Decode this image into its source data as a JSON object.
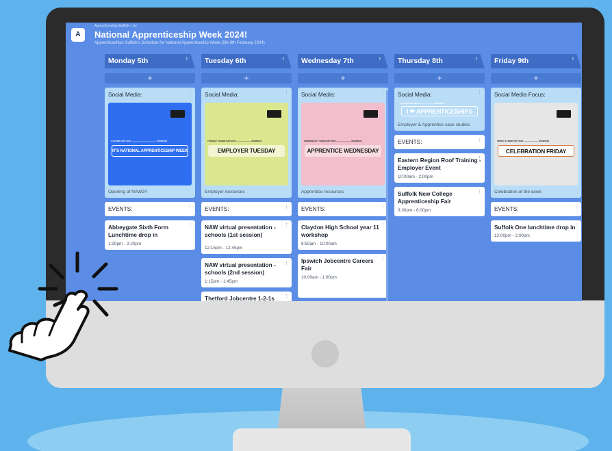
{
  "board": {
    "author": "ApprenticeshipsSuffolk • 1w",
    "logo_letter": "A",
    "title": "National Apprenticeship Week 2024!",
    "subtitle": "Apprenticeships Suffolk's Schedule for National Apprenticeship Week (5th-9th February 2024)"
  },
  "columns": [
    {
      "title": "Monday 5th",
      "social_title": "Social Media:",
      "poster_date": "5-9 FEBRUARY 2024 ———————————— #NAW2024",
      "poster_headline": "IT'S NATIONAL APPRENTICESHIP WEEK",
      "social_caption": "Opening of NAW24",
      "events_label": "EVENTS:",
      "events": [
        {
          "title": "Abbeygate Sixth Form Lunchtime drop in",
          "time": "1:30pm - 2:20pm"
        }
      ]
    },
    {
      "title": "Tuesday 6th",
      "social_title": "Social Media:",
      "poster_date": "TUESDAY 6 FEBRUARY 2024 ——————— #NAW2024",
      "poster_headline": "EMPLOYER TUESDAY",
      "social_caption": "Employer resources",
      "events_label": "EVENTS:",
      "events": [
        {
          "title": "NAW virtual presentation - schools (1st session)",
          "time": "12:15pm - 12:45pm"
        },
        {
          "title": "NAW virtual presentation - schools (2nd session)",
          "time": "1:15pm - 1:45pm"
        },
        {
          "title": "Thetford Jobcentre 1-2-1s",
          "time": ""
        }
      ]
    },
    {
      "title": "Wednesday 7th",
      "social_title": "Social Media:",
      "poster_date": "WEDNESDAY 7 FEBRUARY 2024 ——————— #NAW2024",
      "poster_headline": "APPRENTICE WEDNESDAY",
      "social_caption": "Apprentice resources",
      "events_label": "EVENTS:",
      "events": [
        {
          "title": "Claydon High School year 11 workshop",
          "time": "8:50am - 10:00am"
        },
        {
          "title": "Ipswich Jobcentre Careers Fair",
          "time": "10:00am - 1:00pm"
        }
      ]
    },
    {
      "title": "Thursday 8th",
      "social_title": "Social Media:",
      "poster_date": "8 FEBRUARY 2024 ——————— #NAW2024",
      "poster_headline": "I ❤ APPRENTICESHIPS",
      "social_caption": "Employer & Apprentice case studies",
      "events_label": "EVENTS:",
      "events": [
        {
          "title": "Eastern Region Roof Training - Employer Event",
          "time": "10:00am - 2:00pm"
        },
        {
          "title": "Suffolk New College Apprenticeship Fair",
          "time": "3:30pm - 6:00pm"
        }
      ]
    },
    {
      "title": "Friday 9th",
      "social_title": "Social Media Focus:",
      "poster_date": "FRIDAY 9 FEBRUARY 2024 ——————— #NAW2024",
      "poster_headline": "CELEBRATION FRIDAY",
      "social_caption": "Celebration of the week",
      "events_label": "EVENTS:",
      "events": [
        {
          "title": "Suffolk One lunchtime drop in",
          "time": "12:00pm - 2:00pm"
        }
      ]
    }
  ],
  "ui": {
    "add_symbol": "+",
    "column_menu_symbol": "⁝",
    "card_menu_symbol": "⋮"
  },
  "icons": [
    "kebab-menu-icon",
    "pointing-hand-icon",
    "apprenticeships-logo-icon"
  ],
  "colors": {
    "screen_bg": "#5b8de6",
    "column_header": "#3f6cc4",
    "social_card": "#b9ddf7",
    "backdrop": "#5fb3ec"
  }
}
